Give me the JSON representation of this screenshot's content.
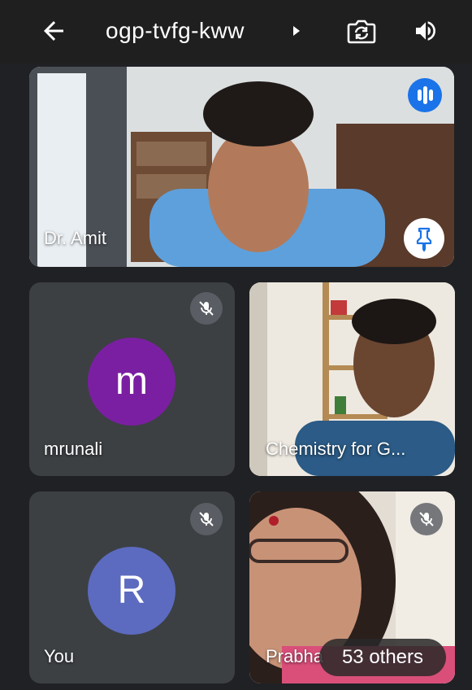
{
  "header": {
    "meeting_code": "ogp-tvfg-kww",
    "back_icon": "arrow-left-icon",
    "switch_camera_icon": "switch-camera-icon",
    "audio_output_icon": "speaker-icon"
  },
  "tiles": {
    "main": {
      "name": "Dr. Amit",
      "status": "speaking",
      "pinnable": true
    },
    "mrunali": {
      "name": "mrunali",
      "avatar_letter": "m",
      "avatar_color": "#7b1fa2",
      "muted": true
    },
    "chemistry": {
      "name": "Chemistry for G..."
    },
    "you": {
      "name": "You",
      "avatar_letter": "R",
      "avatar_color": "#5c6bc0",
      "muted": true
    },
    "prabha": {
      "name": "Prabha",
      "muted": true
    }
  },
  "others_count_label": "53 others",
  "colors": {
    "background": "#202124",
    "tile": "#3c4043",
    "accent": "#1a73e8"
  }
}
